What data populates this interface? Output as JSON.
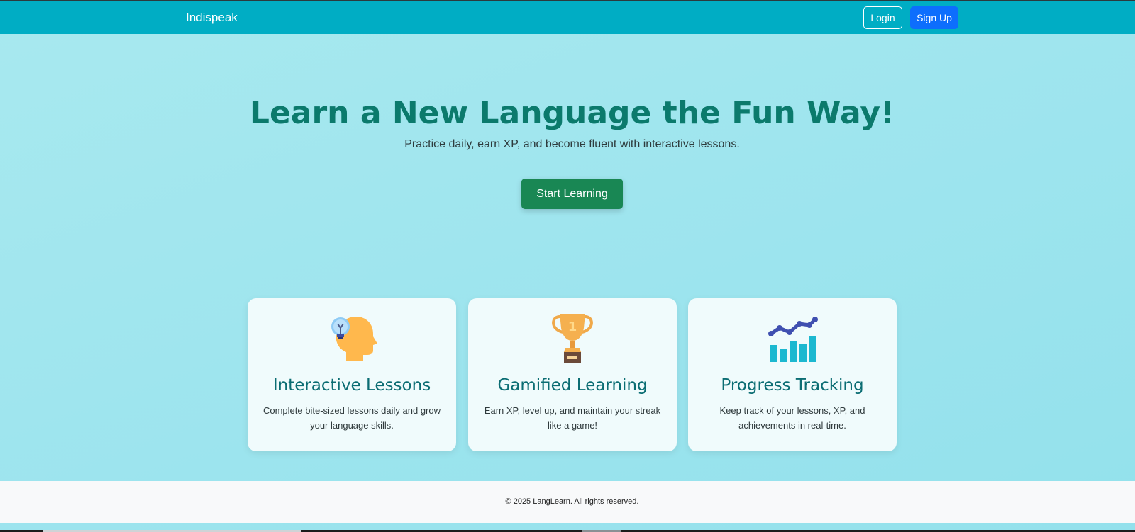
{
  "navbar": {
    "brand": "Indispeak",
    "login_label": "Login",
    "signup_label": "Sign Up"
  },
  "hero": {
    "title": "Learn a New Language the Fun Way!",
    "subtitle": "Practice daily, earn XP, and become fluent with interactive lessons.",
    "cta_label": "Start Learning"
  },
  "features": [
    {
      "icon": "head-lightbulb-icon",
      "title": "Interactive Lessons",
      "description": "Complete bite-sized lessons daily and grow your language skills."
    },
    {
      "icon": "trophy-icon",
      "title": "Gamified Learning",
      "description": "Earn XP, level up, and maintain your streak like a game!"
    },
    {
      "icon": "bar-chart-icon",
      "title": "Progress Tracking",
      "description": "Keep track of your lessons, XP, and achievements in real-time."
    }
  ],
  "footer": {
    "copyright": "© 2025 LangLearn. All rights reserved."
  },
  "colors": {
    "navbar_bg": "#00adc4",
    "hero_title": "#0b7a6c",
    "signup_bg": "#0d6efd",
    "cta_bg": "#198754",
    "card_title": "#0b6d73"
  }
}
